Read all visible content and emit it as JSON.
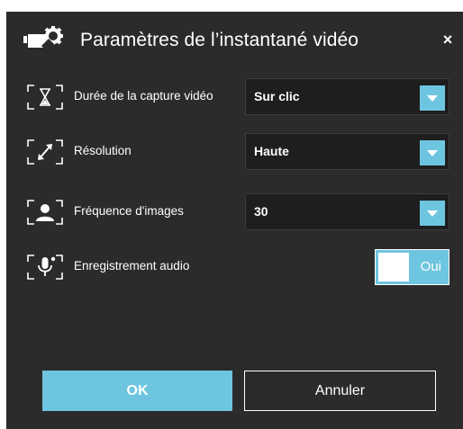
{
  "dialog": {
    "title": "Paramètres de l’instantané vidéo",
    "header_icon": "camera-settings-icon",
    "close_label": "×"
  },
  "settings": [
    {
      "icon": "hourglass-icon",
      "label": "Durée de la capture vidéo",
      "value": "Sur clic",
      "control": "dropdown"
    },
    {
      "icon": "resize-icon",
      "label": "Résolution",
      "value": "Haute",
      "control": "dropdown"
    },
    {
      "icon": "person-icon",
      "label": "Fréquence d'images",
      "value": "30",
      "control": "dropdown"
    },
    {
      "icon": "microphone-icon",
      "label": "Enregistrement audio",
      "value": "Oui",
      "control": "toggle",
      "on": true
    }
  ],
  "buttons": {
    "ok": "OK",
    "cancel": "Annuler"
  },
  "colors": {
    "background": "#2b2b2b",
    "accent": "#6ec5df",
    "field": "#1e1e1e"
  }
}
